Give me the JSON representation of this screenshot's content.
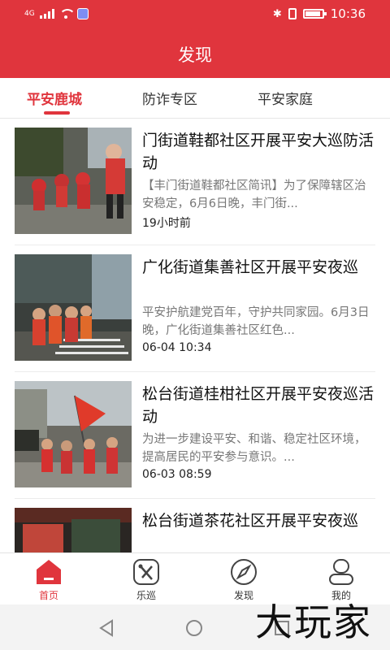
{
  "status_bar": {
    "network": "4G",
    "time": "10:36"
  },
  "header": {
    "title": "发现"
  },
  "tabs": [
    {
      "label": "平安鹿城",
      "active": true
    },
    {
      "label": "防诈专区",
      "active": false
    },
    {
      "label": "平安家庭",
      "active": false
    }
  ],
  "news": [
    {
      "title": "门街道鞋都社区开展平安大巡防活动",
      "desc": "【丰门街道鞋都社区简讯】为了保障辖区治安稳定，6月6日晚，丰门街...",
      "time": "19小时前",
      "thumb_icon": "night-patrol-photo"
    },
    {
      "title": "广化街道集善社区开展平安夜巡",
      "desc": "平安护航建党百年，守护共同家园。6月3日晚，广化街道集善社区红色...",
      "time": "06-04 10:34",
      "thumb_icon": "street-patrol-photo"
    },
    {
      "title": "松台街道桂柑社区开展平安夜巡活动",
      "desc": "为进一步建设平安、和谐、稳定社区环境，提高居民的平安参与意识。...",
      "time": "06-03 08:59",
      "thumb_icon": "red-flag-patrol-photo"
    },
    {
      "title": "松台街道茶花社区开展平安夜巡",
      "desc": "",
      "time": "",
      "thumb_icon": "night-street-photo"
    }
  ],
  "bottom_nav": [
    {
      "label": "首页",
      "icon": "home-icon",
      "active": true
    },
    {
      "label": "乐巡",
      "icon": "patrol-icon",
      "active": false
    },
    {
      "label": "发现",
      "icon": "compass-icon",
      "active": false
    },
    {
      "label": "我的",
      "icon": "profile-icon",
      "active": false
    }
  ],
  "watermark": {
    "text": "大玩家"
  },
  "colors": {
    "brand_red": "#e0353d",
    "text_dark": "#111111",
    "text_gray": "#777777"
  }
}
